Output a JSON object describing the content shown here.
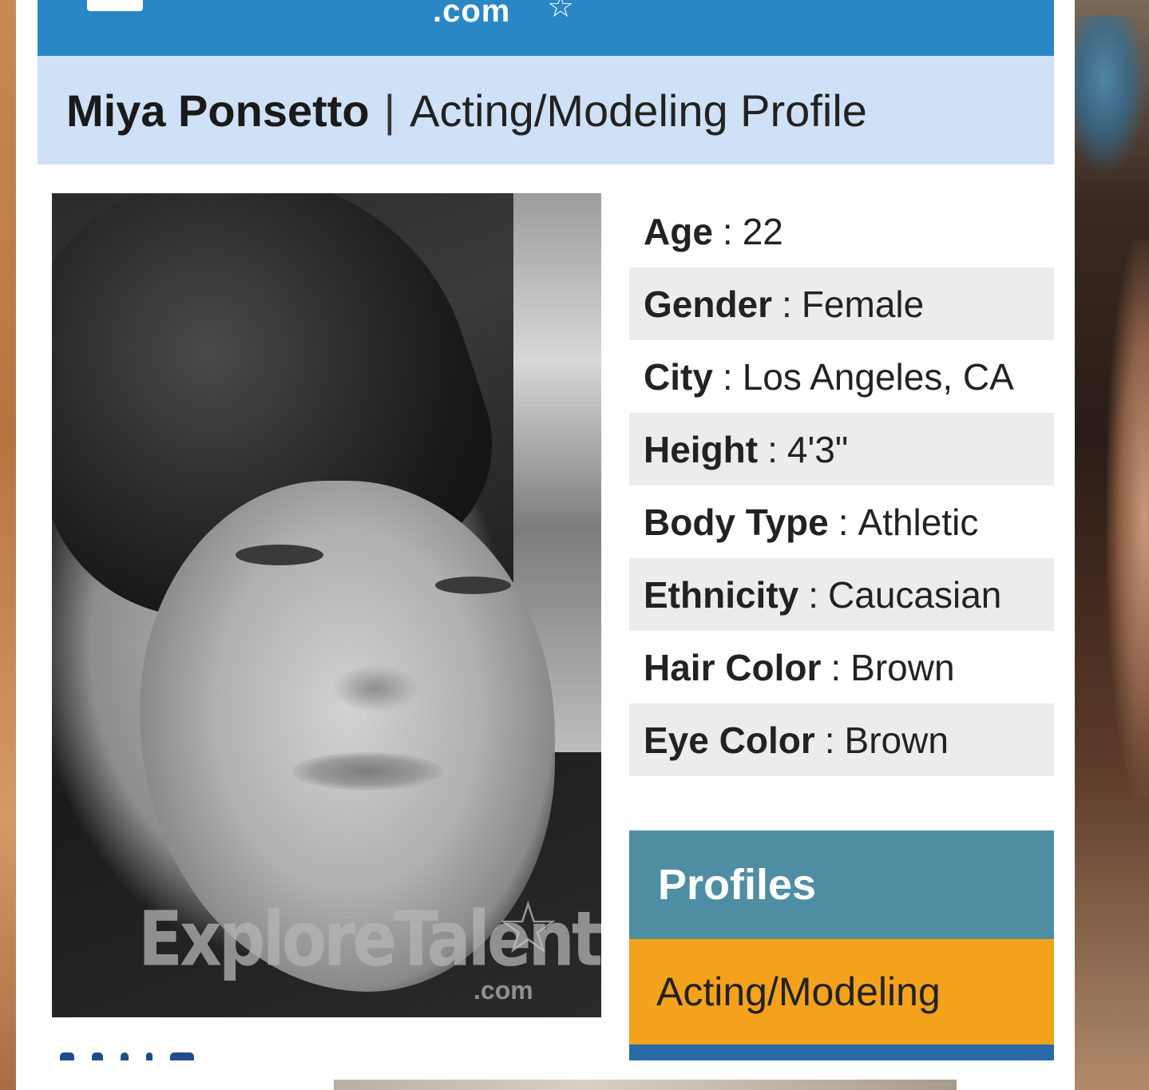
{
  "header": {
    "logo_fragment": ".com"
  },
  "title": {
    "name": "Miya Ponsetto",
    "separator": "|",
    "subtitle": "Acting/Modeling Profile"
  },
  "photo": {
    "watermark": "ExploreTalent",
    "watermark_suffix": ".com"
  },
  "details": [
    {
      "label": "Age",
      "value": "22"
    },
    {
      "label": "Gender",
      "value": "Female"
    },
    {
      "label": "City",
      "value": "Los Angeles, CA"
    },
    {
      "label": "Height",
      "value": "4'3\""
    },
    {
      "label": "Body Type",
      "value": "Athletic"
    },
    {
      "label": "Ethnicity",
      "value": "Caucasian"
    },
    {
      "label": "Hair Color",
      "value": "Brown"
    },
    {
      "label": "Eye Color",
      "value": "Brown"
    }
  ],
  "profiles": {
    "heading": "Profiles",
    "items": [
      "Acting/Modeling"
    ]
  },
  "colors": {
    "top_bar": "#2a87c6",
    "title_bar": "#cfe1f6",
    "profiles_heading": "#4f8ea2",
    "profiles_item": "#f4a21c",
    "profiles_bottom": "#2b6aa9"
  }
}
